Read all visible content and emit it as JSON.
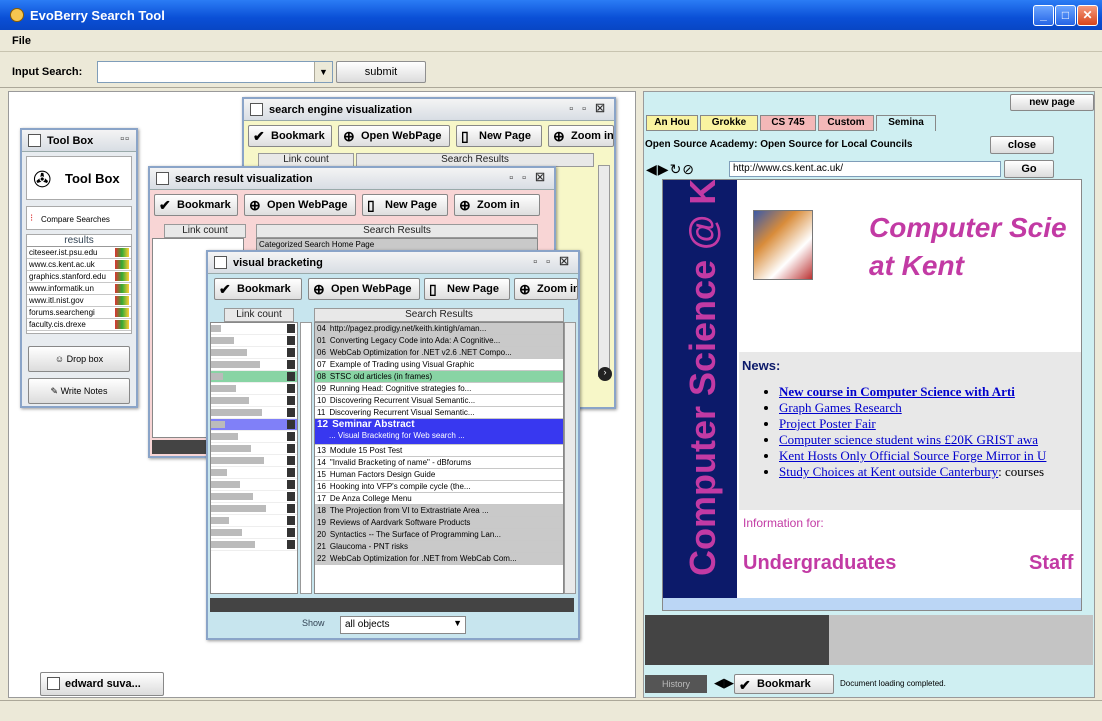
{
  "app": {
    "title": "EvoBerry Search Tool",
    "menu": [
      "File"
    ]
  },
  "search": {
    "label": "Input Search:",
    "value": "",
    "submit": "submit"
  },
  "toolbox": {
    "title": "Tool Box",
    "header": "Tool Box",
    "compare": "Compare Searches",
    "results_label": "results",
    "results": [
      "citeseer.ist.psu.edu",
      "www.cs.kent.ac.uk",
      "graphics.stanford.edu",
      "www.informatik.un",
      "www.itl.nist.gov",
      "forums.searchengi",
      "faculty.cis.drexe"
    ],
    "dropbox": "Drop box",
    "notes": "Write Notes"
  },
  "toolbar": {
    "bookmark": "Bookmark",
    "open": "Open WebPage",
    "newpage": "New Page",
    "zoom": "Zoom in"
  },
  "win1": {
    "title": "search engine visualization",
    "col1": "Link count",
    "col2": "Search Results"
  },
  "win2": {
    "title": "search result visualization",
    "col1": "Link count",
    "col2": "Search Results",
    "first_result": "Categorized Search Home Page"
  },
  "win3": {
    "title": "visual bracketing",
    "col1": "Link count",
    "col2": "Search Results",
    "results": [
      {
        "n": "04",
        "t": "http://pagez.prodigy.net/keith.kintigh/aman...",
        "c": "grey"
      },
      {
        "n": "01",
        "t": "Converting Legacy Code into Ada: A Cognitive...",
        "c": "grey"
      },
      {
        "n": "06",
        "t": "WebCab Optimization for .NET v2.6 .NET Compo...",
        "c": "grey"
      },
      {
        "n": "07",
        "t": "Example of Trading using Visual Graphic",
        "c": ""
      },
      {
        "n": "08",
        "t": "STSC old articles (in frames)",
        "c": "green"
      },
      {
        "n": "09",
        "t": "Running Head: Cognitive strategies fo...",
        "c": ""
      },
      {
        "n": "10",
        "t": "Discovering Recurrent Visual Semantic...",
        "c": ""
      },
      {
        "n": "11",
        "t": "Discovering Recurrent Visual Semantic...",
        "c": ""
      },
      {
        "n": "12",
        "t": "Seminar Abstract",
        "c": "blue",
        "sub": "... Visual Bracketing for Web search ..."
      },
      {
        "n": "13",
        "t": "Module 15 Post Test",
        "c": ""
      },
      {
        "n": "14",
        "t": "\"Invalid Bracketing of name\" - dBforums",
        "c": ""
      },
      {
        "n": "15",
        "t": "Human Factors Design Guide",
        "c": ""
      },
      {
        "n": "16",
        "t": "Hooking into VFP's compile cycle (the...",
        "c": ""
      },
      {
        "n": "17",
        "t": "De Anza College Menu",
        "c": ""
      },
      {
        "n": "18",
        "t": "The Projection from VI to Extrastriate Area ...",
        "c": "grey"
      },
      {
        "n": "19",
        "t": "Reviews of Aardvark Software Products",
        "c": "grey"
      },
      {
        "n": "20",
        "t": "Syntactics -- The Surface of Programming Lan...",
        "c": "grey"
      },
      {
        "n": "21",
        "t": "Glaucoma - PNT risks",
        "c": "grey"
      },
      {
        "n": "22",
        "t": "WebCab Optimization for .NET from WebCab Com...",
        "c": "grey"
      }
    ],
    "show_label": "Show",
    "show_value": "all objects"
  },
  "taskbar": {
    "item": "edward suva..."
  },
  "browser": {
    "newpage": "new page",
    "tabs": [
      "An Hou",
      "Grokke",
      "CS 745",
      "Custom",
      "Semina"
    ],
    "page_title": "Open Source Academy: Open Source for Local Councils",
    "close": "close",
    "url": "http://www.cs.kent.ac.uk/",
    "go": "Go",
    "vertical": "Computer Science @ Kent",
    "heading1": "Computer Scie",
    "heading2": "at Kent",
    "news_label": "News:",
    "news": [
      {
        "text": "New course in Computer Science with Arti",
        "bold": true
      },
      {
        "text": "Graph Games Research",
        "bold": false
      },
      {
        "text": "Project Poster Fair",
        "bold": false
      },
      {
        "text": "Computer science student wins £20K GRIST awa",
        "bold": false
      },
      {
        "text": "Kent Hosts Only Official Source Forge Mirror in U",
        "bold": false
      },
      {
        "text": "Study Choices at Kent outside Canterbury",
        "bold": false,
        "tail": ": courses"
      }
    ],
    "info": "Information for:",
    "undergrad": "Undergraduates",
    "staff": "Staff",
    "history": "History",
    "bookmark": "Bookmark",
    "status": "Document loading completed."
  },
  "colors": {
    "accent": "#0a4fd6",
    "selected": "#3838f0",
    "highlight": "#88d4a4",
    "kent_navy": "#0c1a6a",
    "kent_magenta": "#c23aa4"
  }
}
